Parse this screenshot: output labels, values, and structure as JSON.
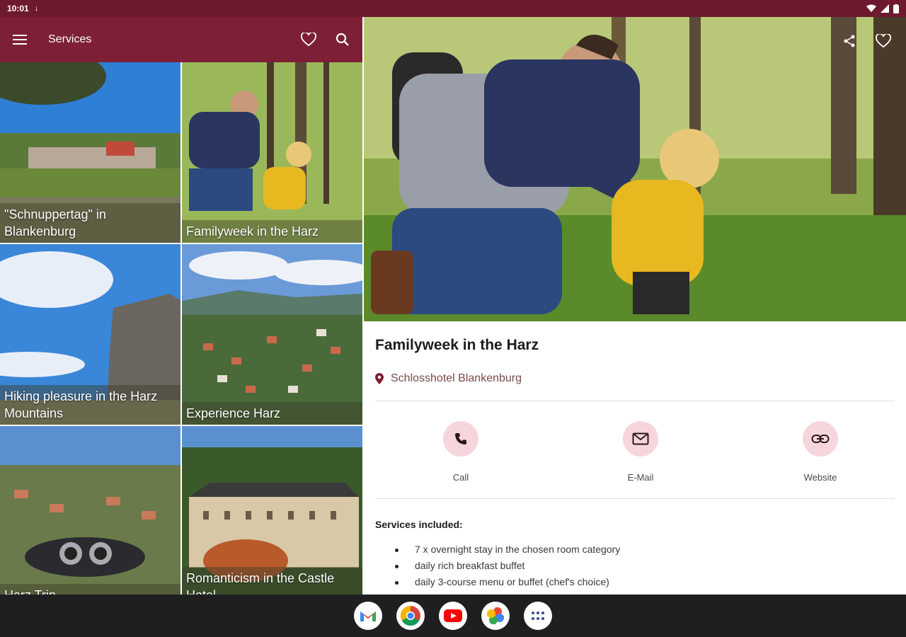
{
  "status_bar": {
    "time": "10:01"
  },
  "app_bar": {
    "title": "Services"
  },
  "tiles": [
    {
      "caption": "\"Schnuppertag\" in Blankenburg"
    },
    {
      "caption": "Familyweek in the Harz"
    },
    {
      "caption": "Hiking pleasure in the Harz Mountains"
    },
    {
      "caption": "Experience Harz"
    },
    {
      "caption": "Harz Trip"
    },
    {
      "caption": "Romanticism in the Castle Hotel"
    }
  ],
  "detail": {
    "title": "Familyweek in the Harz",
    "location": "Schlosshotel Blankenburg",
    "contacts": {
      "call": "Call",
      "email": "E-Mail",
      "website": "Website"
    },
    "services_heading": "Services included:",
    "services": [
      "7 x overnight stay in the chosen room category",
      "daily rich breakfast buffet",
      "daily 3-course menu or buffet (chef's choice)"
    ]
  },
  "colors": {
    "status_bar": "#6d1a2e",
    "app_bar": "#7d1f35",
    "contact_circle": "#f6d6dc",
    "accent": "#7d1f35"
  },
  "taskbar_apps": [
    "gmail-icon",
    "chrome-icon",
    "youtube-icon",
    "photos-icon",
    "app-drawer-icon"
  ]
}
